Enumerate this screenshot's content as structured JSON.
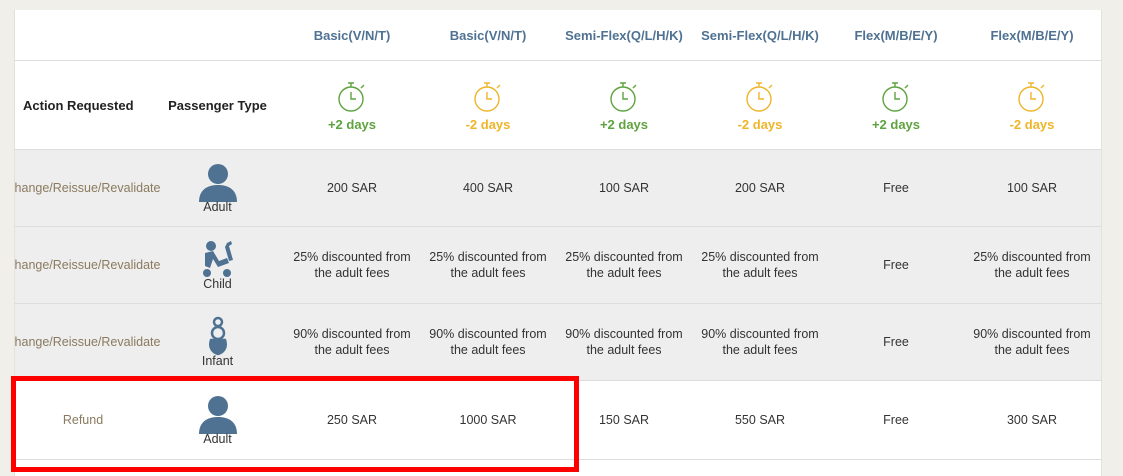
{
  "header": {
    "action_label": "Action Requested",
    "passenger_label": "Passenger Type",
    "fares": [
      {
        "name": "Basic(V/N/T)",
        "days": "+2 days",
        "tone": "green"
      },
      {
        "name": "Basic(V/N/T)",
        "days": "-2 days",
        "tone": "gold"
      },
      {
        "name": "Semi-Flex(Q/L/H/K)",
        "days": "+2 days",
        "tone": "green"
      },
      {
        "name": "Semi-Flex(Q/L/H/K)",
        "days": "-2 days",
        "tone": "gold"
      },
      {
        "name": "Flex(M/B/E/Y)",
        "days": "+2 days",
        "tone": "green"
      },
      {
        "name": "Flex(M/B/E/Y)",
        "days": "-2 days",
        "tone": "gold"
      }
    ],
    "colors": {
      "green": "#5ea33e",
      "gold": "#eeb52a",
      "blue": "#4f7293"
    }
  },
  "rows": [
    {
      "action": "Change/Reissue/Revalidate",
      "passenger": "Adult",
      "icon": "adult-icon",
      "values": [
        "200 SAR",
        "400 SAR",
        "100 SAR",
        "200 SAR",
        "Free",
        "100 SAR"
      ]
    },
    {
      "action": "Change/Reissue/Revalidate",
      "passenger": "Child",
      "icon": "child-stroller-icon",
      "values": [
        "25% discounted from the adult fees",
        "25% discounted from the adult fees",
        "25% discounted from the adult fees",
        "25% discounted from the adult fees",
        "Free",
        "25% discounted from the adult fees"
      ]
    },
    {
      "action": "Change/Reissue/Revalidate",
      "passenger": "Infant",
      "icon": "infant-icon",
      "values": [
        "90% discounted from the adult fees",
        "90% discounted from the adult fees",
        "90% discounted from the adult fees",
        "90% discounted from the adult fees",
        "Free",
        "90% discounted from the adult fees"
      ]
    },
    {
      "action": "Refund",
      "passenger": "Adult",
      "icon": "adult-icon",
      "values": [
        "250 SAR",
        "1000 SAR",
        "150 SAR",
        "550 SAR",
        "Free",
        "300 SAR"
      ]
    }
  ]
}
